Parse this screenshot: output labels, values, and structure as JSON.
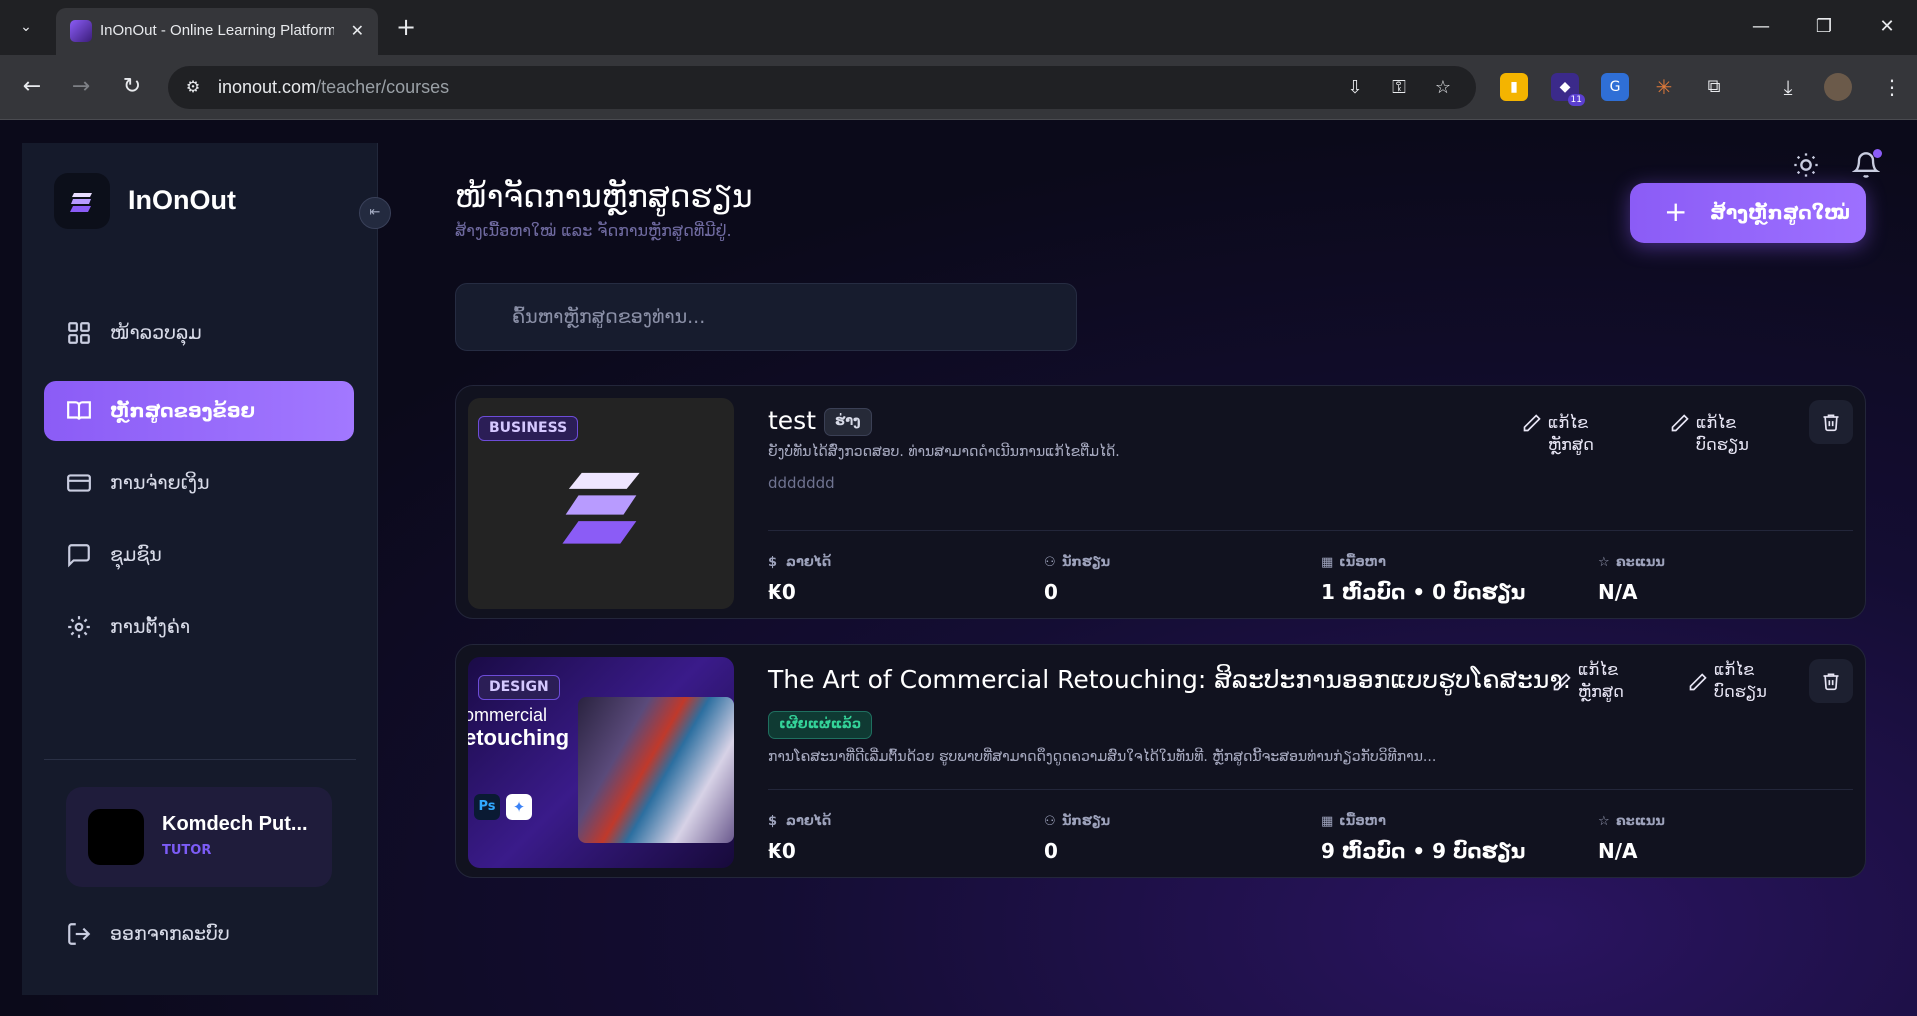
{
  "browser": {
    "tab_title": "InOnOut - Online Learning Platform",
    "url_host": "inonout.com",
    "url_path": "/teacher/courses",
    "extension_badge": "11"
  },
  "sidebar": {
    "brand": "InOnOut",
    "items": [
      {
        "label": "ໜ້າລວບລຸມ",
        "icon": "grid-icon",
        "active": false
      },
      {
        "label": "ຫຼັກສູດຂອງຂ້ອຍ",
        "icon": "book-icon",
        "active": true
      },
      {
        "label": "ການຈ່າຍເງິນ",
        "icon": "credit-card-icon",
        "active": false
      },
      {
        "label": "ຊຸມຊົນ",
        "icon": "chat-icon",
        "active": false
      },
      {
        "label": "ການຕັ້ງຄ່າ",
        "icon": "gear-icon",
        "active": false
      }
    ],
    "user": {
      "name": "Komdech Put...",
      "role": "TUTOR"
    },
    "logout_label": "ອອກຈາກລະບົບ"
  },
  "main": {
    "title": "ໜ້າຈັດການຫຼັກສູດຮຽນ",
    "subtitle": "ສ້າງເນື້ອຫາໃໝ່ ແລະ ຈັດການຫຼັກສູດທີ່ມີຢູ່.",
    "create_button": "ສ້າງຫຼັກສູດໃໝ່",
    "search_placeholder": "ຄົ້ນຫາຫຼັກສູດຂອງທ່ານ..."
  },
  "courses": [
    {
      "category": "BUSINESS",
      "title": "test",
      "status": "ຮ່າງ",
      "description": "ຍັງບໍ່ທັນໄດ້ສົ່ງກວດສອບ. ທ່ານສາມາດດຳເນີນການແກ້ໄຂຕື່ມໄດ້.",
      "extra": "ddddddd",
      "edit_course_label": "ແກ້ໄຂຫຼັກສູດ",
      "edit_lesson_label": "ແກ້ໄຂບົດຮຽນ",
      "stats": {
        "revenue_label": "ລາຍໄດ້",
        "revenue": "₭0",
        "students_label": "ນັກຮຽນ",
        "students": "0",
        "content_label": "ເນື້ອຫາ",
        "content": "1 ຫົວບົດ • 0 ບົດຮຽນ",
        "rating_label": "ຄະແນນ",
        "rating": "N/A"
      }
    },
    {
      "category": "DESIGN",
      "title": "The Art of Commercial Retouching: ສິລະປະການອອກແບບຮູບໂຄສະນາ.",
      "status": "ເຜີຍແຜ່ແລ້ວ",
      "description": "ການໂຄສະນາທີ່ດີເລີ່ມຕົ້ນດ້ວຍ ຮູບພາບທີ່ສາມາດດຶງດູດຄວາມສົນໃຈໄດ້ໃນທັນທີ. ຫຼັກສູດນີ້ຈະສອນທ່ານກ່ຽວກັບວິທີການ...",
      "edit_course_label": "ແກ້ໄຂ ຫຼັກສູດ",
      "edit_lesson_label": "ແກ້ໄຂ ບົດຮຽນ",
      "thumb_text_1": "ommercial",
      "thumb_text_2": "etouching",
      "thumb_ps": "Ps",
      "stats": {
        "revenue_label": "ລາຍໄດ້",
        "revenue": "₭0",
        "students_label": "ນັກຮຽນ",
        "students": "0",
        "content_label": "ເນື້ອຫາ",
        "content": "9 ຫົວບົດ • 9 ບົດຮຽນ",
        "rating_label": "ຄະແນນ",
        "rating": "N/A"
      }
    }
  ],
  "colors": {
    "accent": "#8b5cf6",
    "background": "#0b0a1a",
    "card": "#11121f",
    "published": "#34d399"
  }
}
